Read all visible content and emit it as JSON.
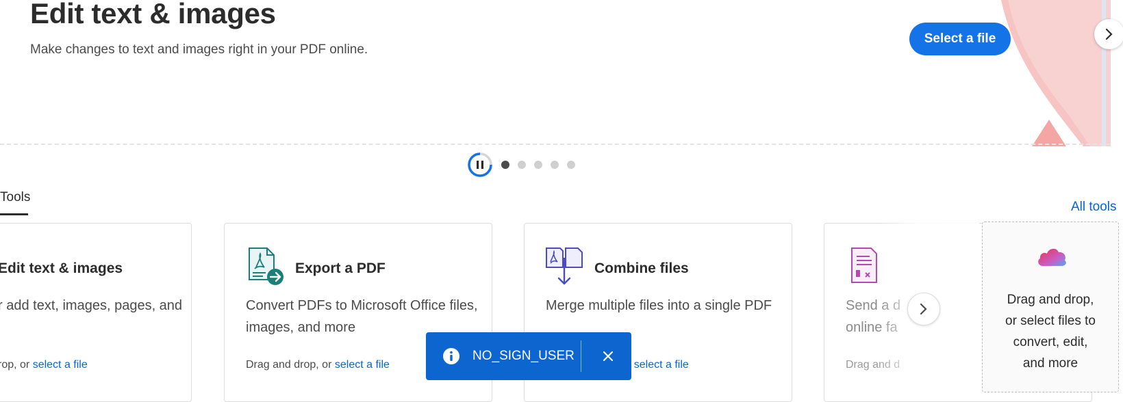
{
  "hero": {
    "title": "Edit text & images",
    "subtitle": "Make changes to text and images right in your PDF online.",
    "cta_label": "Select a file"
  },
  "carousel": {
    "slide_count": 5,
    "active_index": 0
  },
  "tabs": {
    "tools_label": "Tools"
  },
  "all_tools_label": "All tools",
  "cards": [
    {
      "title": "Edit text & images",
      "description": "r add text, images, pages, and",
      "footer_prefix": "rop, or",
      "footer_link": "select a file"
    },
    {
      "title": "Export a PDF",
      "description_line1": "Convert PDFs to Microsoft Office files,",
      "description_line2": "images, and more",
      "footer_prefix": "Drag and drop, or",
      "footer_link": "select a file"
    },
    {
      "title": "Combine files",
      "description": "Merge multiple files into a single PDF",
      "footer_link": "r select a file"
    },
    {
      "description_line1": "Send a d",
      "description_line2": "online fa",
      "footer_prefix": "Drag and d"
    }
  ],
  "dropzone": {
    "line1": "Drag and drop,",
    "line2": "or select files to",
    "line3": "convert, edit,",
    "line4": "and more"
  },
  "toast": {
    "message": "NO_SIGN_USER"
  },
  "colors": {
    "accent": "#1473e6",
    "link": "#0265dc",
    "toast_bg": "#0d66d0"
  }
}
